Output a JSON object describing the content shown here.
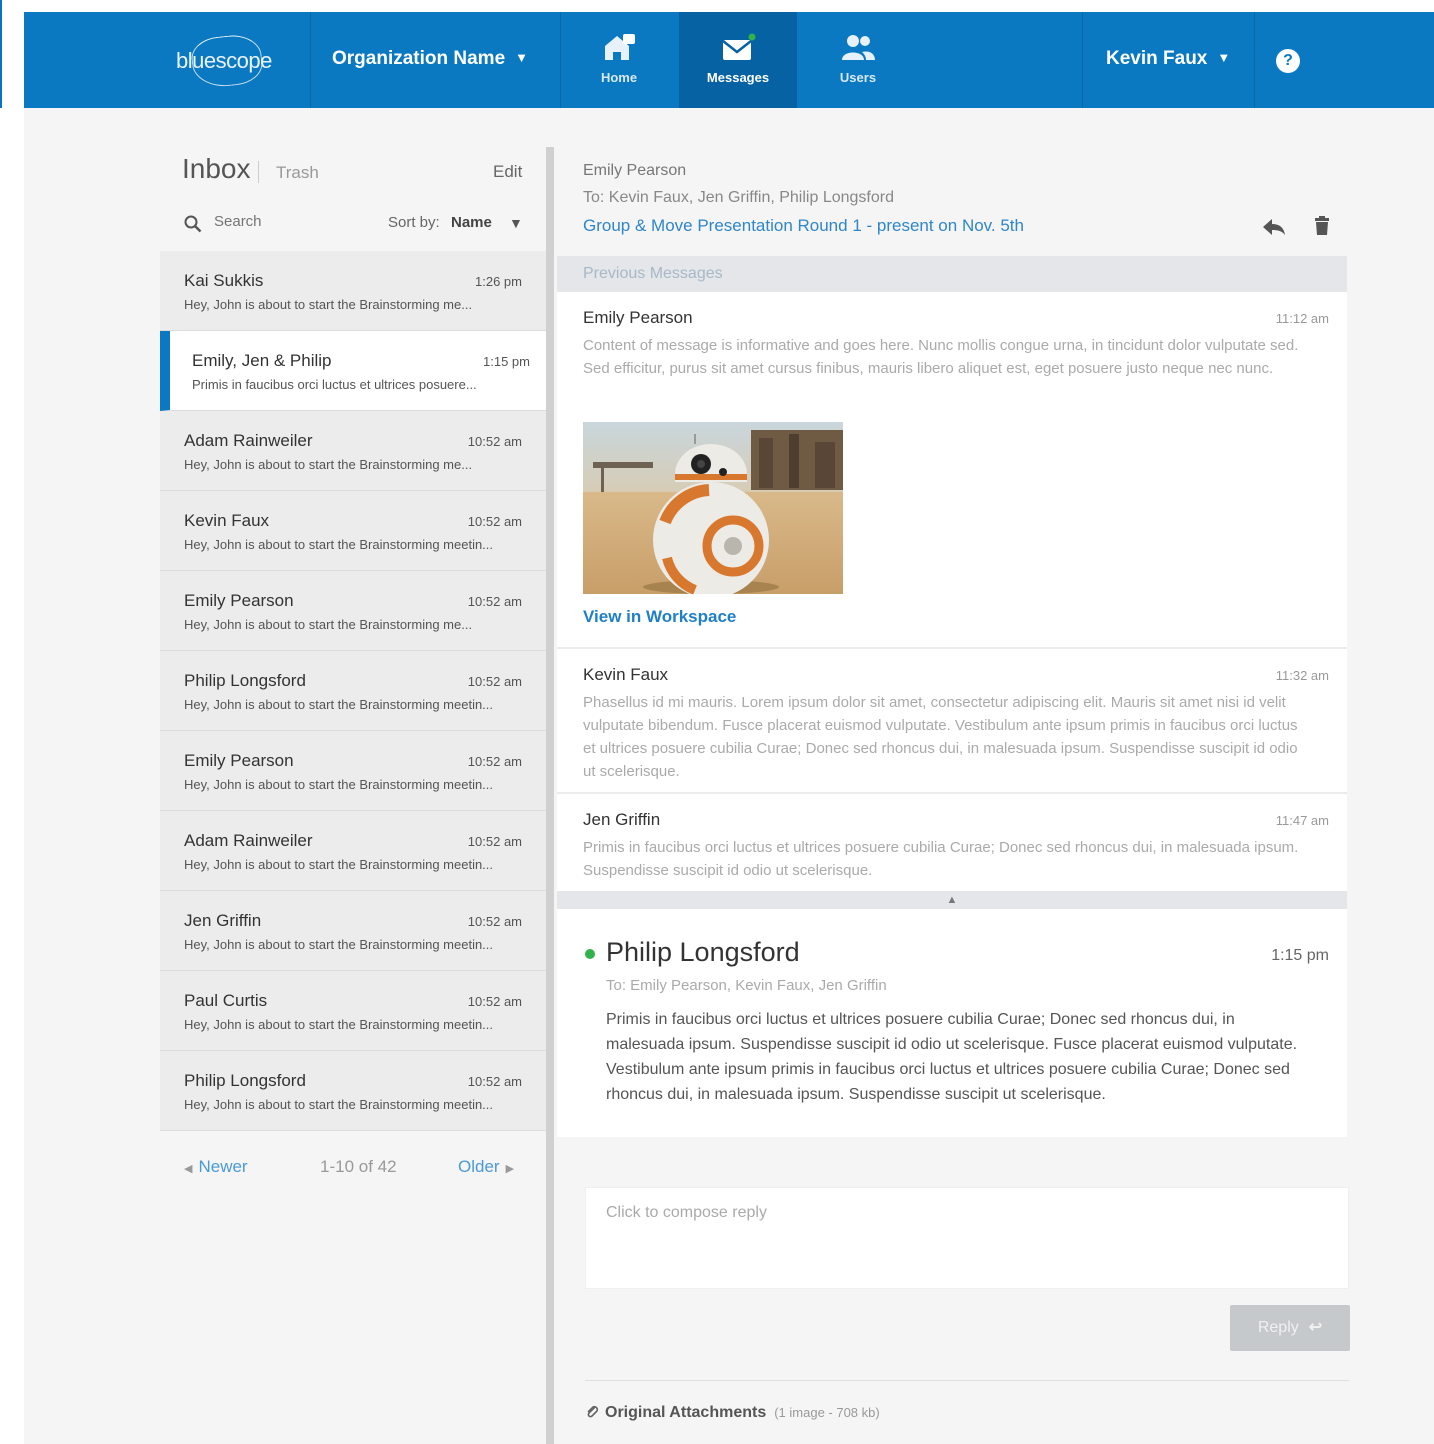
{
  "header": {
    "logo_text": "bluescope",
    "org_name": "Organization Name",
    "nav": [
      {
        "label": "Home",
        "icon": "home-icon"
      },
      {
        "label": "Messages",
        "icon": "envelope-icon"
      },
      {
        "label": "Users",
        "icon": "users-icon"
      }
    ],
    "active_nav": "Messages",
    "user_name": "Kevin Faux",
    "help_glyph": "?"
  },
  "inbox": {
    "title": "Inbox",
    "trash_label": "Trash",
    "edit_label": "Edit",
    "search_placeholder": "Search",
    "sort_label": "Sort by:",
    "sort_value": "Name",
    "messages": [
      {
        "sender": "Kai Sukkis",
        "time": "1:26 pm",
        "preview": "Hey, John is about to start the Brainstorming me..."
      },
      {
        "sender": "Emily, Jen & Philip",
        "time": "1:15 pm",
        "preview": "Primis in faucibus orci luctus et ultrices posuere..."
      },
      {
        "sender": "Adam Rainweiler",
        "time": "10:52 am",
        "preview": "Hey, John is about to start the Brainstorming me..."
      },
      {
        "sender": "Kevin Faux",
        "time": "10:52 am",
        "preview": "Hey, John is about to start the Brainstorming meetin..."
      },
      {
        "sender": "Emily Pearson",
        "time": "10:52 am",
        "preview": "Hey, John is about to start the Brainstorming me..."
      },
      {
        "sender": "Philip Longsford",
        "time": "10:52 am",
        "preview": "Hey, John is about to start the Brainstorming meetin..."
      },
      {
        "sender": "Emily Pearson",
        "time": "10:52 am",
        "preview": "Hey, John is about to start the Brainstorming meetin..."
      },
      {
        "sender": "Adam Rainweiler",
        "time": "10:52 am",
        "preview": "Hey, John is about to start the Brainstorming meetin..."
      },
      {
        "sender": "Jen Griffin",
        "time": "10:52 am",
        "preview": "Hey, John is about to start the Brainstorming meetin..."
      },
      {
        "sender": "Paul Curtis",
        "time": "10:52 am",
        "preview": "Hey, John is about to start the Brainstorming meetin..."
      },
      {
        "sender": "Philip Longsford",
        "time": "10:52 am",
        "preview": "Hey, John is about to start the Brainstorming meetin..."
      }
    ],
    "active_index": 1,
    "pager": {
      "newer": "Newer",
      "count": "1-10 of 42",
      "older": "Older"
    }
  },
  "conversation": {
    "from": "Emily Pearson",
    "to": "To: Kevin Faux, Jen Griffin, Philip Longsford",
    "subject": "Group & Move Presentation Round 1 - present on Nov. 5th",
    "previous_label": "Previous Messages",
    "thread": [
      {
        "sender": "Emily Pearson",
        "time": "11:12 am",
        "body": "Content of message is informative and goes here. Nunc mollis congue urna, in tincidunt dolor vulputate sed. Sed efficitur, purus sit amet cursus finibus, mauris libero aliquet est, eget posuere justo neque nec nunc.",
        "link": "View in Workspace"
      },
      {
        "sender": "Kevin Faux",
        "time": "11:32 am",
        "body": "Phasellus id mi mauris. Lorem ipsum dolor sit amet, consectetur adipiscing elit. Mauris sit amet nisi id velit vulputate bibendum. Fusce placerat euismod vulputate. Vestibulum ante ipsum primis in faucibus orci luctus et ultrices posuere cubilia Curae; Donec sed rhoncus dui, in malesuada ipsum. Suspendisse suscipit id odio ut scelerisque."
      },
      {
        "sender": "Jen Griffin",
        "time": "11:47 am",
        "body": "Primis in faucibus orci luctus et ultrices posuere cubilia Curae; Donec sed rhoncus dui, in malesuada ipsum. Suspendisse suscipit id odio ut scelerisque."
      }
    ],
    "latest": {
      "sender": "Philip Longsford",
      "time": "1:15 pm",
      "to": "To: Emily Pearson, Kevin Faux, Jen Griffin",
      "body": "Primis in faucibus orci luctus et ultrices posuere cubilia Curae; Donec sed rhoncus dui, in malesuada ipsum. Suspendisse suscipit id odio ut scelerisque. Fusce placerat euismod vulputate. Vestibulum ante ipsum primis in faucibus orci luctus et ultrices posuere cubilia Curae; Donec sed rhoncus dui, in malesuada ipsum. Suspendisse suscipit ut scelerisque."
    },
    "compose_placeholder": "Click to compose reply",
    "reply_label": "Reply",
    "attachments_label": "Original Attachments",
    "attachments_meta": "(1 image - 708 kb)"
  },
  "colors": {
    "brand_blue": "#0a79c2",
    "active_nav": "#0662a3",
    "link_blue": "#2f86c9",
    "online_green": "#31b24a"
  }
}
